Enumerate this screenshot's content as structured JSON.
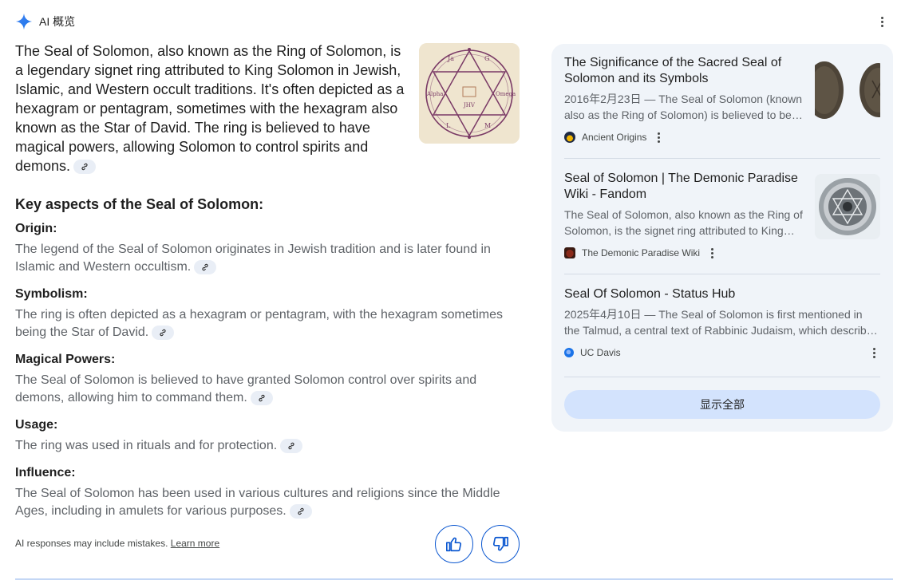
{
  "header": {
    "title": "AI 概览"
  },
  "intro": {
    "text": "The Seal of Solomon, also known as the Ring of Solomon, is a legendary signet ring attributed to King Solomon in Jewish, Islamic, and Western occult traditions. It's often depicted as a hexagram or pentagram, sometimes with the hexagram also known as the Star of David. The ring is believed to have magical powers, allowing Solomon to control spirits and demons."
  },
  "key_title": "Key aspects of the Seal of Solomon:",
  "aspects": [
    {
      "head": "Origin:",
      "body": "The legend of the Seal of Solomon originates in Jewish tradition and is later found in Islamic and Western occultism."
    },
    {
      "head": "Symbolism:",
      "body": "The ring is often depicted as a hexagram or pentagram, with the hexagram sometimes being the Star of David."
    },
    {
      "head": "Magical Powers:",
      "body": "The Seal of Solomon is believed to have granted Solomon control over spirits and demons, allowing him to command them."
    },
    {
      "head": "Usage:",
      "body": "The ring was used in rituals and for protection."
    },
    {
      "head": "Influence:",
      "body": "The Seal of Solomon has been used in various cultures and religions since the Middle Ages, including in amulets for various purposes."
    }
  ],
  "footer": {
    "note": "AI responses may include mistakes.",
    "learn_more": "Learn more"
  },
  "sources": [
    {
      "title": "The Significance of the Sacred Seal of Solomon and its Symbols",
      "snippet": "2016年2月23日 — The Seal of Solomon (known also as the Ring of Solomon) is believed to be…",
      "source": "Ancient Origins"
    },
    {
      "title": "Seal of Solomon | The Demonic Paradise Wiki - Fandom",
      "snippet": "The Seal of Solomon, also known as the Ring of Solomon, is the signet ring attributed to King…",
      "source": "The Demonic Paradise Wiki"
    },
    {
      "title": "Seal Of Solomon - Status Hub",
      "snippet": "2025年4月10日 — The Seal of Solomon is first mentioned in the Talmud, a central text of Rabbinic Judaism, which describ…",
      "source": "UC Davis"
    }
  ],
  "show_all": "显示全部",
  "colors": {
    "accent": "#0b57d0",
    "panel_bg": "#f0f4f9",
    "button_bg": "#d3e3fd"
  }
}
